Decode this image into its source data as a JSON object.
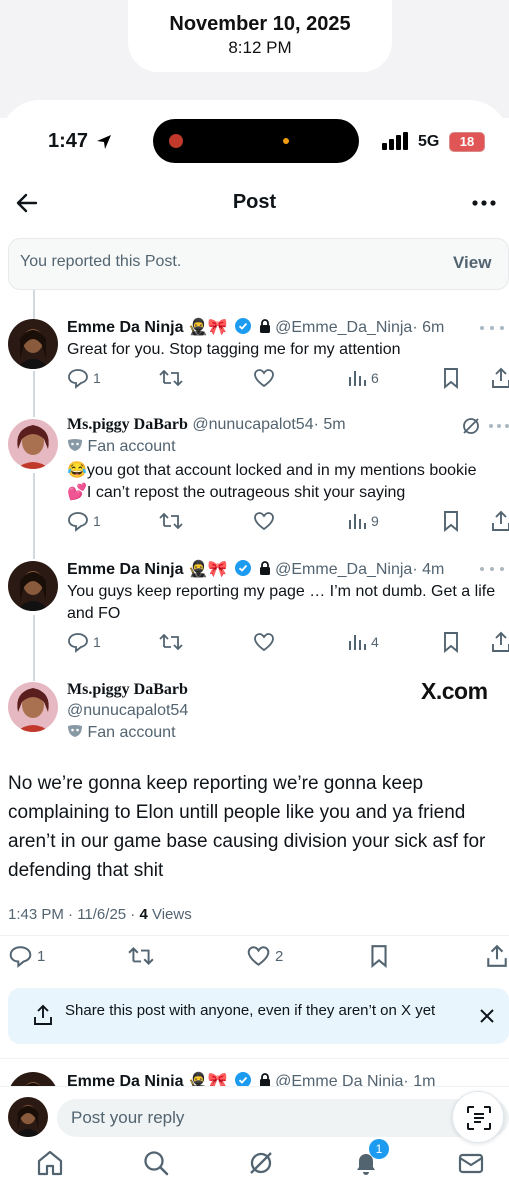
{
  "overlay": {
    "date": "November 10, 2025",
    "time": "8:12 PM"
  },
  "status_bar": {
    "time": "1:47",
    "network": "5G",
    "battery": "18"
  },
  "header": {
    "title": "Post"
  },
  "banner": {
    "text": "You reported this Post.",
    "action": "View"
  },
  "replies": [
    {
      "name": "Emme Da Ninja",
      "handle": "@Emme_Da_Ninja",
      "time": "· 6m",
      "text": "Great for you. Stop tagging me for my attention",
      "replies": "1",
      "views": "6"
    },
    {
      "name": "Ms.piggy DaBarb",
      "handle": "@nunucapalot54",
      "time": "· 5m",
      "label": "Fan account",
      "text": "😂you got that account locked and in my mentions bookie 💕I can’t repost the outrageous shit your saying",
      "replies": "1",
      "views": "9"
    },
    {
      "name": "Emme Da Ninja",
      "handle": "@Emme_Da_Ninja",
      "time": "· 4m",
      "text": "You guys keep reporting my page … I’m not dumb. Get a life and FO",
      "replies": "1",
      "views": "4"
    }
  ],
  "main_post": {
    "name": "Ms.piggy DaBarb",
    "handle": "@nunucapalot54",
    "label": "Fan account",
    "watermark": "X.com",
    "text": "No we’re gonna keep reporting we’re gonna keep complaining to Elon untill people like you and ya friend aren’t in our game base causing division your sick asf for defending that shit",
    "timestamp": "1:43 PM · 11/6/25 · ",
    "views_count": "4",
    "views_label": " Views",
    "replies": "1",
    "likes": "2"
  },
  "share_prompt": {
    "text": "Share this post with anyone, even if they aren’t on X yet"
  },
  "next_reply": {
    "name": "Emme Da Ninja",
    "handle": "@Emme Da Ninja",
    "time": "· 1m"
  },
  "compose": {
    "placeholder": "Post your reply"
  },
  "tabbar": {
    "notification_count": "1"
  },
  "colors": {
    "accent": "#1d9bf0",
    "text": "#0f1419",
    "muted": "#536471",
    "banner_bg": "#f7f9f9",
    "share_bg": "#e8f5fd"
  },
  "icons": [
    "back-arrow-icon",
    "more-icon",
    "verified-icon",
    "lock-icon",
    "grok-icon",
    "reply-icon",
    "repost-icon",
    "like-icon",
    "views-icon",
    "bookmark-icon",
    "share-icon",
    "close-icon",
    "home-icon",
    "search-icon",
    "notifications-icon",
    "messages-icon",
    "scan-icon"
  ]
}
